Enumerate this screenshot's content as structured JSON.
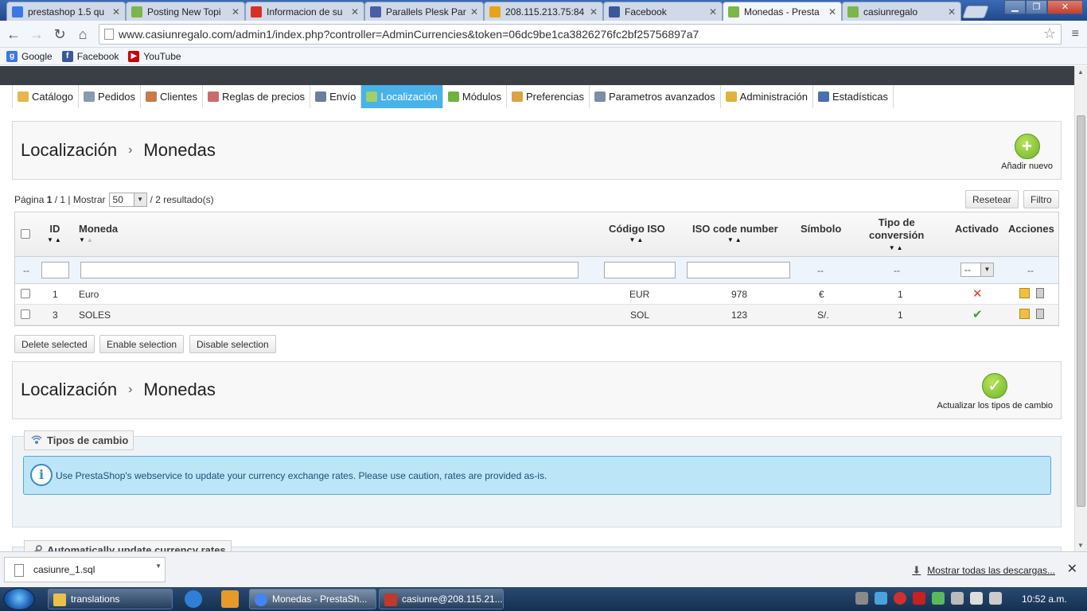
{
  "browser": {
    "tabs": [
      {
        "title": "prestashop 1.5 qu",
        "favicon_color": "#3b78e7"
      },
      {
        "title": "Posting New Topi",
        "favicon_color": "#7ab648"
      },
      {
        "title": "Informacion de su",
        "favicon_color": "#d93025"
      },
      {
        "title": "Parallels Plesk Par",
        "favicon_color": "#4a5ea8"
      },
      {
        "title": "208.115.213.75:84",
        "favicon_color": "#e8a317"
      },
      {
        "title": "Facebook",
        "favicon_color": "#3b5998"
      },
      {
        "title": "Monedas - Presta",
        "favicon_color": "#7ab648",
        "active": true
      },
      {
        "title": "casiunregalo",
        "favicon_color": "#7ab648"
      }
    ],
    "url": "www.casiunregalo.com/admin1/index.php?controller=AdminCurrencies&token=06dc9be1ca3826276fc2bf25756897a7",
    "bookmarks": [
      {
        "label": "Google",
        "icon_color": "#3b78e7",
        "glyph": "g"
      },
      {
        "label": "Facebook",
        "icon_color": "#3b5998",
        "glyph": "f"
      },
      {
        "label": "YouTube",
        "icon_color": "#cc0000",
        "glyph": "▶"
      }
    ]
  },
  "admin": {
    "menu": [
      {
        "label": "Catálogo",
        "icon_color": "#e6b84a"
      },
      {
        "label": "Pedidos",
        "icon_color": "#8a9bb0"
      },
      {
        "label": "Clientes",
        "icon_color": "#c97b4a"
      },
      {
        "label": "Reglas de precios",
        "icon_color": "#c96b6b"
      },
      {
        "label": "Envío",
        "icon_color": "#6b7f9a"
      },
      {
        "label": "Localización",
        "icon_color": "#9fd06a",
        "active": true
      },
      {
        "label": "Módulos",
        "icon_color": "#6cb33e"
      },
      {
        "label": "Preferencias",
        "icon_color": "#d9a441"
      },
      {
        "label": "Parametros avanzados",
        "icon_color": "#7a8fa8"
      },
      {
        "label": "Administración",
        "icon_color": "#e0b33c"
      },
      {
        "label": "Estadísticas",
        "icon_color": "#4a6fb3"
      }
    ],
    "breadcrumb": {
      "section": "Localización",
      "separator": "›",
      "page": "Monedas"
    },
    "add_new_label": "Añadir nuevo",
    "pagination": {
      "page_label": "Página",
      "page": "1",
      "of": "/ 1 | Mostrar",
      "per_page": "50",
      "results": "/ 2 resultado(s)"
    },
    "reset_label": "Resetear",
    "filter_label": "Filtro",
    "table": {
      "headers": {
        "id": "ID",
        "currency": "Moneda",
        "iso_code": "Código ISO",
        "iso_number": "ISO code number",
        "symbol": "Símbolo",
        "conversion_line1": "Tipo de",
        "conversion_line2": "conversión",
        "enabled": "Activado",
        "actions": "Acciones"
      },
      "filter_dash": "--",
      "filter_select_value": "--",
      "rows": [
        {
          "id": "1",
          "name": "Euro",
          "iso": "EUR",
          "iso_num": "978",
          "symbol": "€",
          "rate": "1",
          "enabled": "✕",
          "enabled_color": "#e03a2e"
        },
        {
          "id": "3",
          "name": "SOLES",
          "iso": "SOL",
          "iso_num": "123",
          "symbol": "S/.",
          "rate": "1",
          "enabled": "✔",
          "enabled_color": "#3aa13a"
        }
      ]
    },
    "bulk": {
      "delete": "Delete selected",
      "enable": "Enable selection",
      "disable": "Disable selection"
    },
    "update_rates_label": "Actualizar los tipos de cambio",
    "exchange_section": {
      "title": "Tipos de cambio",
      "info": "Use PrestaShop's webservice to update your currency exchange rates. Please use caution, rates are provided as-is."
    },
    "auto_section_title": "Automatically update currency rates"
  },
  "downloads": {
    "file": "casiunre_1.sql",
    "show_all": "Mostrar todas las descargas..."
  },
  "taskbar": {
    "items": [
      {
        "label": "translations",
        "icon_color": "#e8c24a"
      },
      {
        "label": "Monedas - PrestaSh...",
        "icon_color": "#4285f4"
      },
      {
        "label": "casiunre@208.115.21...",
        "icon_color": "#c0392b"
      }
    ],
    "clock": "10:52 a.m."
  },
  "colors": {
    "accent_menu": "#49b2e9",
    "add_icon": "#6fb42a",
    "info_bg": "#bde5f8"
  }
}
